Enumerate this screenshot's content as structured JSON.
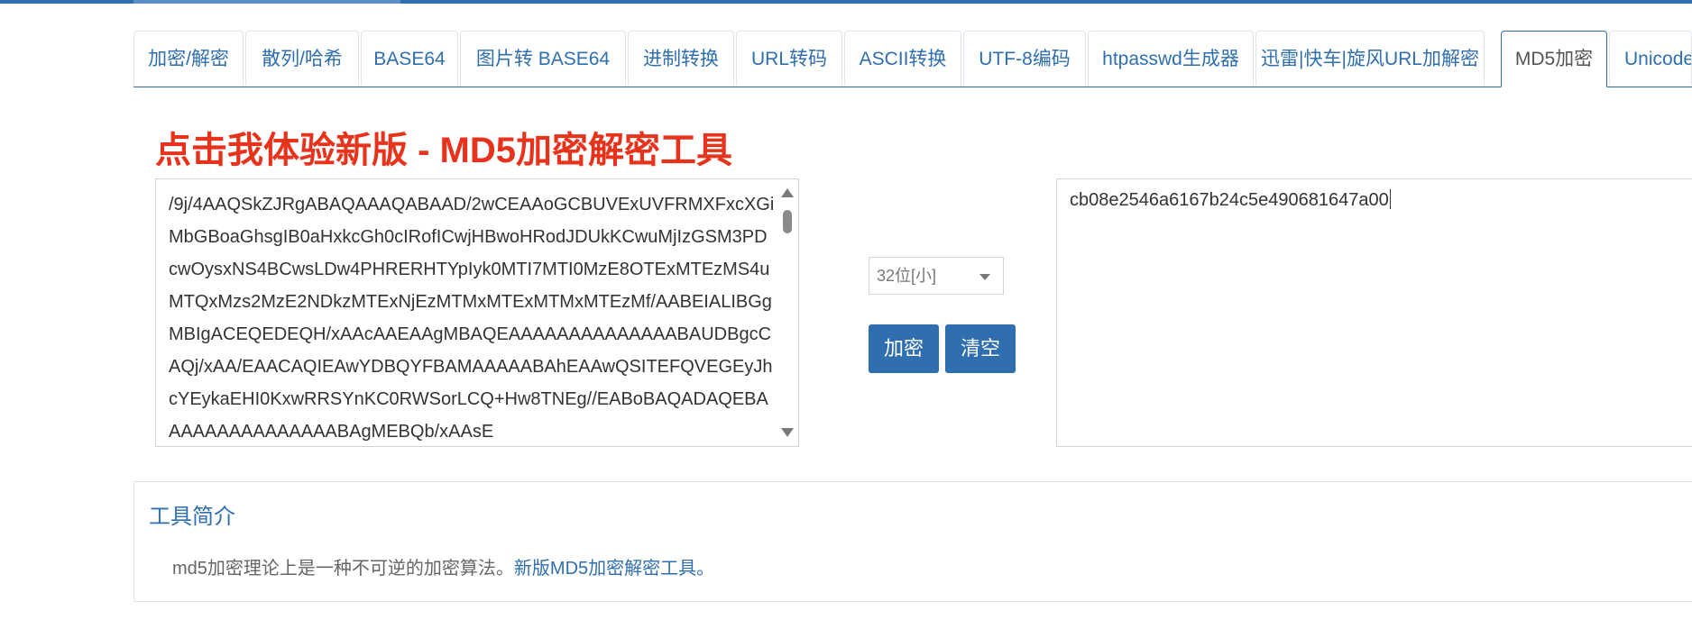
{
  "tabs": [
    {
      "label": "加密/解密"
    },
    {
      "label": "散列/哈希"
    },
    {
      "label": "BASE64"
    },
    {
      "label": "图片转 BASE64"
    },
    {
      "label": "进制转换"
    },
    {
      "label": "URL转码"
    },
    {
      "label": "ASCII转换"
    },
    {
      "label": "UTF-8编码"
    },
    {
      "label": "htpasswd生成器"
    },
    {
      "label": "迅雷|快车|旋风URL加解密"
    },
    {
      "label": "MD5加密"
    },
    {
      "label": "Unicode"
    }
  ],
  "active_tab": "MD5加密",
  "promo": {
    "text": "点击我体验新版 - MD5加密解密工具"
  },
  "input": {
    "value": "/9j/4AAQSkZJRgABAQAAAQABAAD/2wCEAAoGCBUVExUVFRMXFxcXGiMbGBoaGhsgIB0aHxkcGh0cIRofICwjHBwoHRodJDUkKCwuMjIzGSM3PDcwOysxNS4BCwsLDw4PHRERHTYpIyk0MTI7MTI0MzE8OTExMTEzMS4uMTQxMzs2MzE2NDkzMTExNjEzMTMxMTExMTMxMTEzMf/AABEIALIBGgMBIgACEQEDEQH/xAAcAAEAAgMBAQEAAAAAAAAAAAAAABAUDBgcCAQj/xAA/EAACAQIEAwYDBQYFBAMAAAAABAhEAAwQSITEFQVEGEyJhcYEykaEHI0KxwRRSYnKC0RWSorLCQ+Hw8TNEg//EABoBAQADAQEBAAAAAAAAAAAAAAABAgMEBQb/xAAsE"
  },
  "bit_select": {
    "value": "32位[小]"
  },
  "buttons": {
    "encrypt": "加密",
    "clear": "清空"
  },
  "output": {
    "value": "cb08e2546a6167b24c5e490681647a00"
  },
  "intro": {
    "title": "工具简介",
    "body": "md5加密理论上是一种不可逆的加密算法。",
    "link": "新版MD5加密解密工具。"
  },
  "colors": {
    "accent": "#2f6fb0",
    "promo": "#e8331c"
  }
}
